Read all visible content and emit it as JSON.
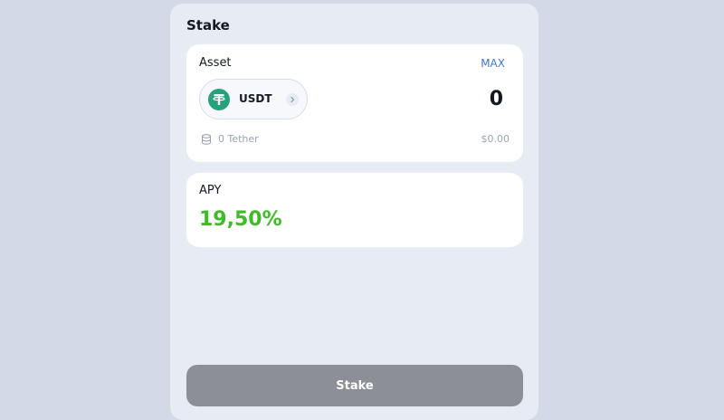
{
  "panel": {
    "title": "Stake"
  },
  "asset": {
    "label": "Asset",
    "max_label": "MAX",
    "token": {
      "symbol": "USDT",
      "icon": "tether-icon",
      "icon_color": "#26a17b"
    },
    "amount": "0",
    "balance_text": "0 Tether",
    "usd_value": "$0.00"
  },
  "apy": {
    "label": "APY",
    "value": "19,50%",
    "value_color": "#3cbd23"
  },
  "action": {
    "stake_label": "Stake",
    "disabled": true
  },
  "colors": {
    "accent_link": "#3f74d8",
    "button_disabled": "#8c8f95"
  }
}
